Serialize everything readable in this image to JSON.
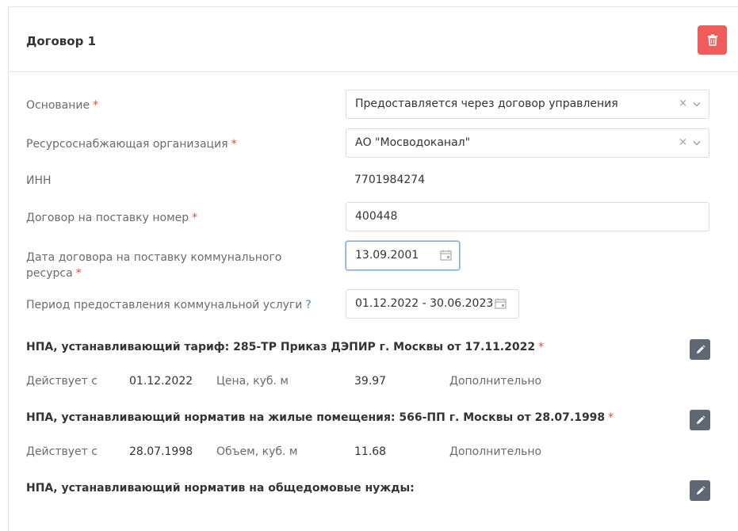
{
  "card": {
    "title": "Договор 1"
  },
  "fields": {
    "osnovanie": {
      "label": "Основание",
      "required": "*",
      "value": "Предоставляется через договор управления",
      "clear": "×"
    },
    "org": {
      "label": "Ресурсоснабжающая организация",
      "required": "*",
      "value": "АО \"Мосводоканал\"",
      "clear": "×"
    },
    "inn": {
      "label": "ИНН",
      "value": "7701984274"
    },
    "contract_number": {
      "label": "Договор на поставку номер",
      "required": "*",
      "value": "400448"
    },
    "contract_date": {
      "label_line1": "Дата договора на поставку коммунального",
      "label_line2": "ресурса",
      "required": "*",
      "value": "13.09.2001"
    },
    "period": {
      "label": "Период предоставления коммунальной услуги",
      "help": "?",
      "value": "01.12.2022 - 30.06.2023"
    }
  },
  "npa_tariff": {
    "title": "НПА, устанавливающий тариф: 285-ТР Приказ ДЭПИР г. Москвы от 17.11.2022",
    "required": "*",
    "valid_from_label": "Действует с",
    "valid_from": "01.12.2022",
    "metric_label": "Цена, куб. м",
    "metric_value": "39.97",
    "extra": "Дополнительно"
  },
  "npa_norm_living": {
    "title": "НПА, устанавливающий норматив на жилые помещения: 566-ПП г. Москвы от 28.07.1998",
    "required": "*",
    "valid_from_label": "Действует с",
    "valid_from": "28.07.1998",
    "metric_label": "Объем, куб. м",
    "metric_value": "11.68",
    "extra": "Дополнительно"
  },
  "npa_norm_common": {
    "title": "НПА, устанавливающий норматив на общедомовые нужды:"
  },
  "colors": {
    "delete": "#f05b5b",
    "required": "#e74c3c",
    "help": "#3c8dbc",
    "edit": "#5f6772",
    "focus": "#7aa7e8"
  },
  "icons": {
    "delete": "trash-icon",
    "edit": "pencil-icon",
    "calendar": "calendar-icon",
    "dropdown": "chevron-down-icon"
  }
}
